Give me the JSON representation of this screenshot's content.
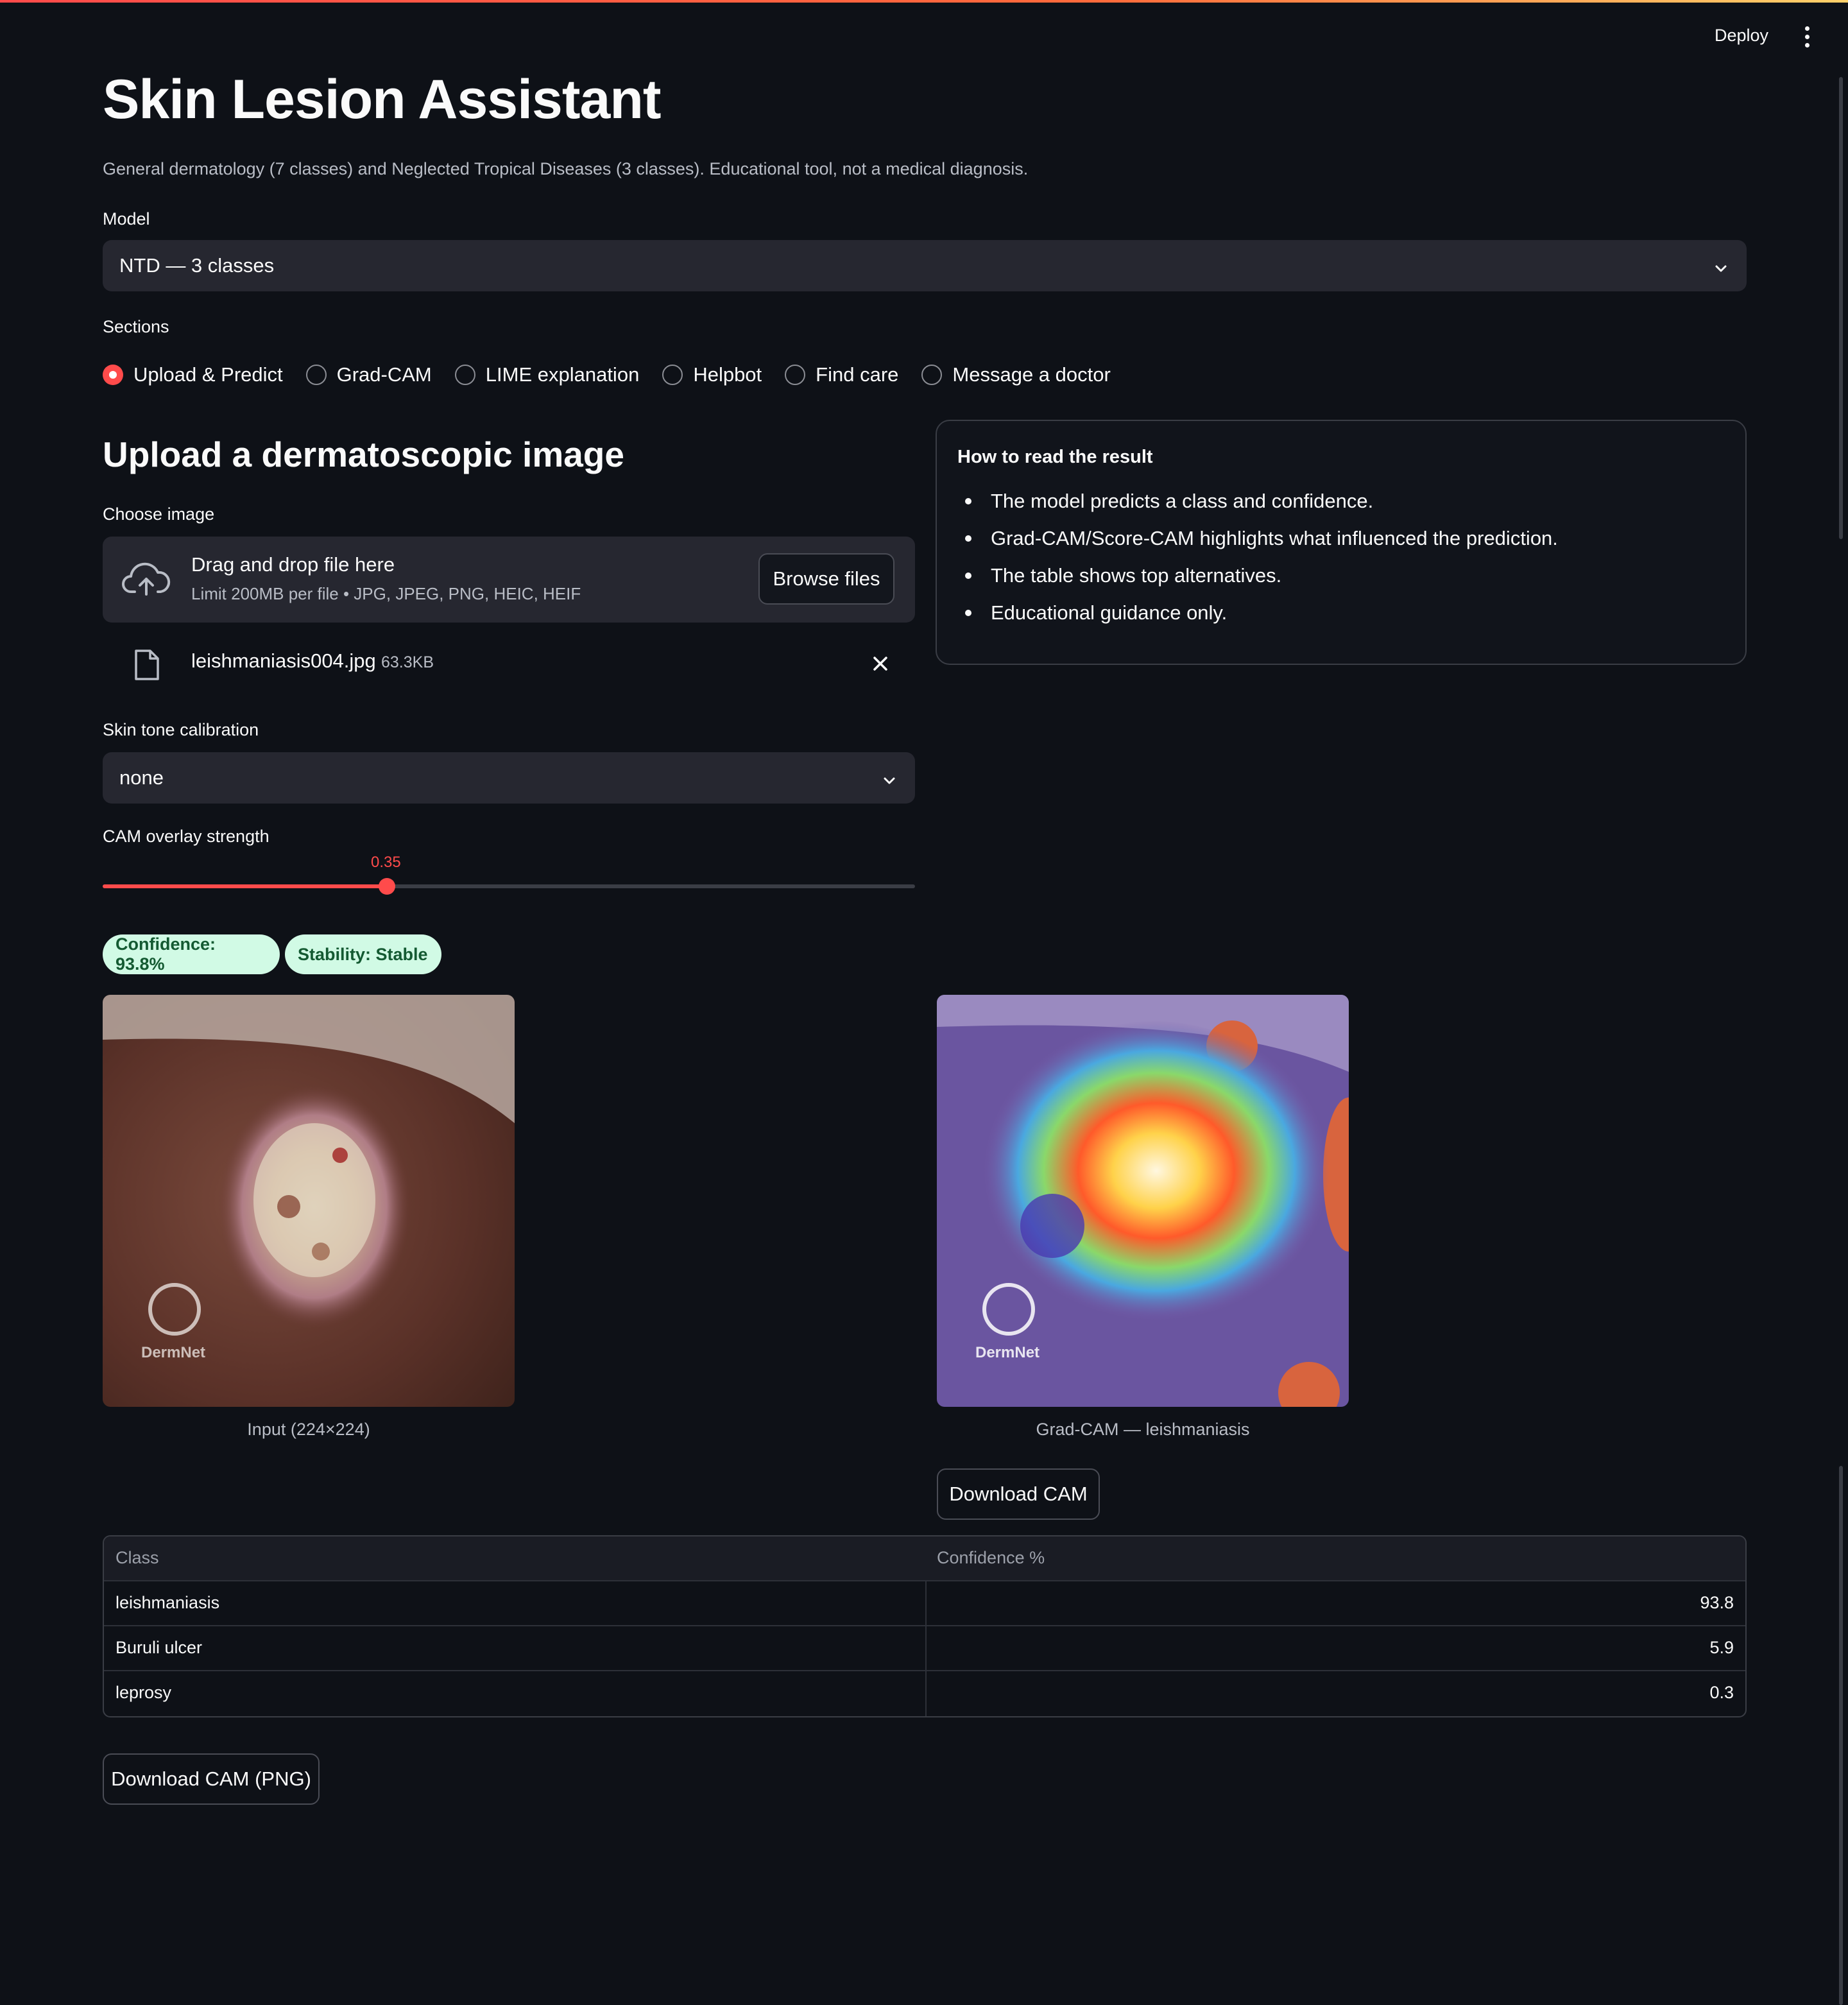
{
  "header": {
    "deploy_label": "Deploy",
    "menu_icon": "kebab-menu-icon"
  },
  "page": {
    "title": "Skin Lesion Assistant",
    "subtitle": "General dermatology (7 classes) and Neglected Tropical Diseases (3 classes). Educational tool, not a medical diagnosis."
  },
  "model": {
    "label": "Model",
    "value": "NTD — 3 classes"
  },
  "sections": {
    "label": "Sections",
    "options": [
      "Upload & Predict",
      "Grad-CAM",
      "LIME explanation",
      "Helpbot",
      "Find care",
      "Message a doctor"
    ],
    "selected": "Upload & Predict"
  },
  "upload": {
    "heading": "Upload a dermatoscopic image",
    "label": "Choose image",
    "drop_title": "Drag and drop file here",
    "drop_limit": "Limit 200MB per file • JPG, JPEG, PNG, HEIC, HEIF",
    "browse_label": "Browse files",
    "file_name": "leishmaniasis004.jpg",
    "file_size": "63.3KB"
  },
  "skin_tone": {
    "label": "Skin tone calibration",
    "value": "none"
  },
  "cam_slider": {
    "label": "CAM overlay strength",
    "value": "0.35",
    "fraction": 0.35
  },
  "info": {
    "title": "How to read the result",
    "items": [
      "The model predicts a class and confidence.",
      "Grad-CAM/Score-CAM highlights what influenced the prediction.",
      "The table shows top alternatives.",
      "Educational guidance only."
    ]
  },
  "badges": {
    "confidence": "Confidence: 93.8%",
    "stability": "Stability: Stable"
  },
  "images": {
    "input_caption": "Input (224×224)",
    "cam_caption": "Grad-CAM — leishmaniasis",
    "watermark": "DermNet",
    "download_cam_label": "Download CAM"
  },
  "table": {
    "headers": [
      "Class",
      "Confidence %"
    ],
    "rows": [
      {
        "class": "leishmaniasis",
        "confidence": "93.8"
      },
      {
        "class": "Buruli ulcer",
        "confidence": "5.9"
      },
      {
        "class": "leprosy",
        "confidence": "0.3"
      }
    ]
  },
  "download_png_label": "Download CAM (PNG)",
  "colors": {
    "accent": "#ff4b4b",
    "background": "#0e1117",
    "badge_bg": "#d1fae5",
    "badge_text": "#145a32"
  }
}
